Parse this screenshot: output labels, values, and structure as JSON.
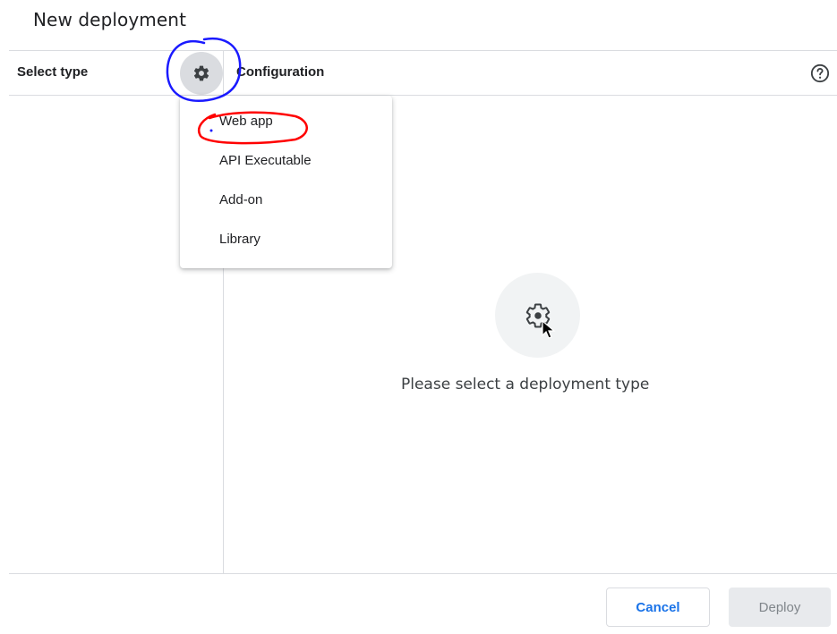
{
  "dialog": {
    "title": "New deployment"
  },
  "sidebar": {
    "label": "Select type",
    "gear_button_icon": "gear-icon"
  },
  "header": {
    "config_label": "Configuration",
    "help_icon": "help-circle-icon"
  },
  "menu": {
    "items": [
      {
        "label": "Web app"
      },
      {
        "label": "API Executable"
      },
      {
        "label": "Add-on"
      },
      {
        "label": "Library"
      }
    ]
  },
  "main": {
    "empty_icon": "gear-icon",
    "empty_text": "Please select a deployment type"
  },
  "footer": {
    "cancel_label": "Cancel",
    "deploy_label": "Deploy"
  },
  "colors": {
    "accent": "#1a73e8",
    "annotation_blue": "#1a1aff",
    "annotation_red": "#ff0000"
  }
}
